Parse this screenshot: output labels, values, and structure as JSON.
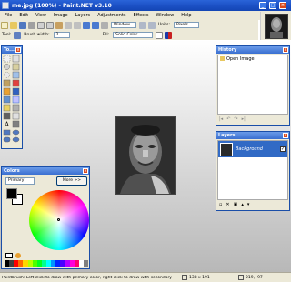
{
  "window": {
    "title": "me.jpg (100%) - Paint.NET v3.10"
  },
  "menu": [
    "File",
    "Edit",
    "View",
    "Image",
    "Layers",
    "Adjustments",
    "Effects",
    "Window",
    "Help"
  ],
  "toolbar1": {
    "window_label": "Window",
    "units_label": "Units:",
    "units_value": "Pixels"
  },
  "toolbar2": {
    "tool_label": "Tool:",
    "brush_width_label": "Brush width:",
    "brush_width_value": "2",
    "fill_label": "Fill:",
    "fill_value": "Solid Color"
  },
  "tools_panel": {
    "title": "To..."
  },
  "history_panel": {
    "title": "History",
    "items": [
      "Open Image"
    ]
  },
  "layers_panel": {
    "title": "Layers",
    "layers": [
      {
        "name": "Background",
        "visible": true
      }
    ]
  },
  "colors_panel": {
    "title": "Colors",
    "mode_value": "Primary",
    "more_label": "More >>"
  },
  "statusbar": {
    "hint": "Paintbrush: Left click to draw with primary color, right click to draw with secondary",
    "image_size": "138 x 191",
    "cursor_pos": "219, -97"
  },
  "colors": {
    "titlebar": "#1b4fc4",
    "panel_bg": "#ece9d8",
    "accent": "#316ac5"
  }
}
